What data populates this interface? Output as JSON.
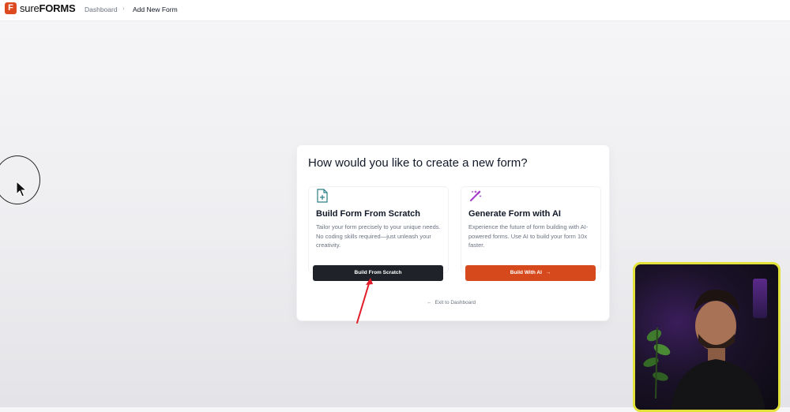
{
  "brand": {
    "name_light": "sure",
    "name_bold": "FORMS",
    "mark": "F",
    "color": "#dd4a1f"
  },
  "breadcrumb": {
    "dashboard": "Dashboard",
    "separator": "›",
    "current": "Add New Form"
  },
  "dialog": {
    "title": "How would you like to create a new form?",
    "options": [
      {
        "icon": "file-plus-icon",
        "title": "Build Form From Scratch",
        "description": "Tailor your form precisely to your unique needs. No coding skills required—just unleash your creativity.",
        "button_label": "Build From Scratch",
        "button_color": "#1f2329"
      },
      {
        "icon": "magic-wand-icon",
        "title": "Generate Form with AI",
        "description": "Experience the future of form building with AI-powered forms. Use AI to build your form 10x faster.",
        "button_label": "Build With AI",
        "button_arrow": "→",
        "button_color": "#d5491d"
      }
    ],
    "exit_arrow": "←",
    "exit_label": "Exit to Dashboard"
  },
  "overlay": {
    "annotation_color": "#e11d2a",
    "webcam_border_color": "#e2e23a"
  }
}
